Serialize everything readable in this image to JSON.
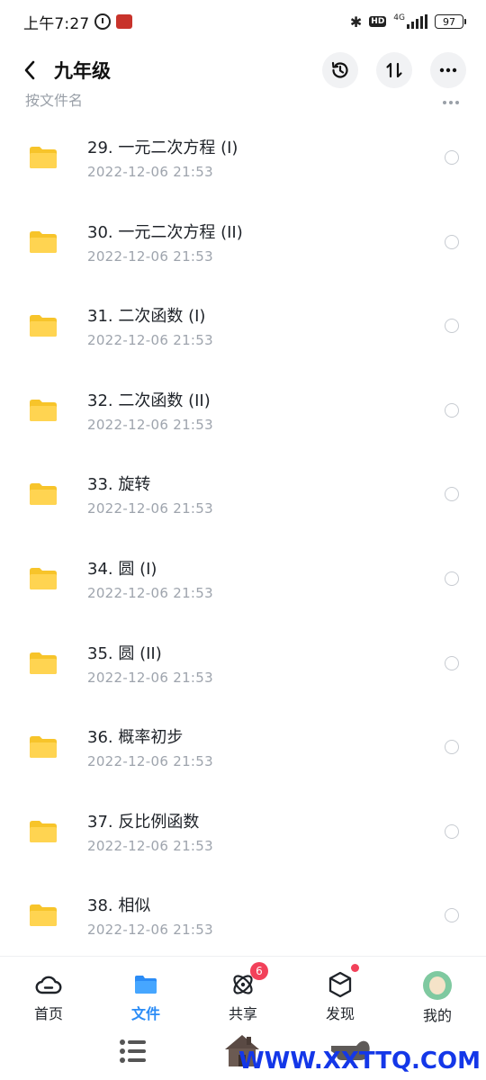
{
  "status_bar": {
    "time": "上午7:27",
    "hd": "HD",
    "network": "4G",
    "battery": "97"
  },
  "header": {
    "title": "九年级"
  },
  "sort": {
    "label": "按文件名"
  },
  "files": [
    {
      "name": "29. 一元二次方程 (I)",
      "date": "2022-12-06   21:53"
    },
    {
      "name": "30. 一元二次方程 (II)",
      "date": "2022-12-06   21:53"
    },
    {
      "name": "31. 二次函数 (I)",
      "date": "2022-12-06   21:53"
    },
    {
      "name": "32. 二次函数 (II)",
      "date": "2022-12-06   21:53"
    },
    {
      "name": "33. 旋转",
      "date": "2022-12-06   21:53"
    },
    {
      "name": "34. 圆 (I)",
      "date": "2022-12-06   21:53"
    },
    {
      "name": "35. 圆 (II)",
      "date": "2022-12-06   21:53"
    },
    {
      "name": "36. 概率初步",
      "date": "2022-12-06   21:53"
    },
    {
      "name": "37. 反比例函数",
      "date": "2022-12-06   21:53"
    },
    {
      "name": "38. 相似",
      "date": "2022-12-06   21:53"
    }
  ],
  "bottom_nav": {
    "home": "首页",
    "files": "文件",
    "share": "共享",
    "share_badge": "6",
    "discover": "发现",
    "me": "我的"
  },
  "watermark": "WWW.XXTTQ.COM",
  "colors": {
    "accent": "#2b8cf6",
    "folder": "#ffd451",
    "badge": "#f2415a",
    "watermark": "#1437e8"
  }
}
